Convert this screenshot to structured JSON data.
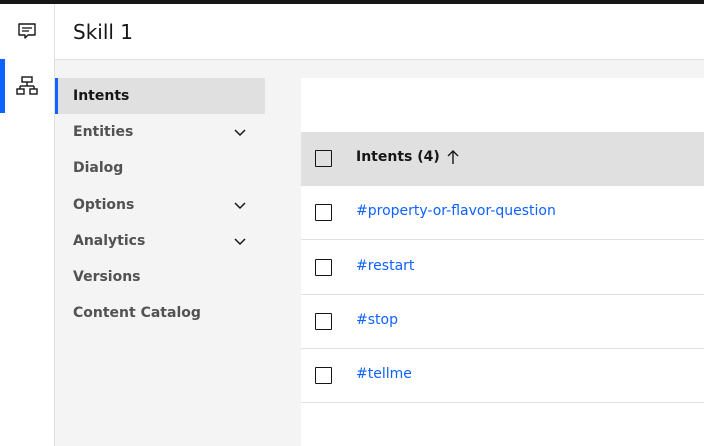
{
  "skill": {
    "title": "Skill 1"
  },
  "rail": {
    "items": [
      {
        "icon": "chat-icon"
      },
      {
        "icon": "skill-tree-icon",
        "active": true
      }
    ]
  },
  "sidebar": {
    "items": [
      {
        "label": "Intents",
        "selected": true,
        "expandable": false
      },
      {
        "label": "Entities",
        "expandable": true
      },
      {
        "label": "Dialog",
        "expandable": false
      },
      {
        "label": "Options",
        "expandable": true
      },
      {
        "label": "Analytics",
        "expandable": true
      },
      {
        "label": "Versions",
        "expandable": false
      },
      {
        "label": "Content Catalog",
        "expandable": false
      }
    ]
  },
  "table": {
    "header": "Intents (4)",
    "sort_icon": "arrow-up-icon",
    "rows": [
      {
        "name": "#property-or-flavor-question"
      },
      {
        "name": "#restart"
      },
      {
        "name": "#stop"
      },
      {
        "name": "#tellme"
      }
    ]
  },
  "colors": {
    "accent": "#0f62fe",
    "sidebar_bg": "#f4f4f4",
    "header_bg": "#e0e0e0"
  }
}
